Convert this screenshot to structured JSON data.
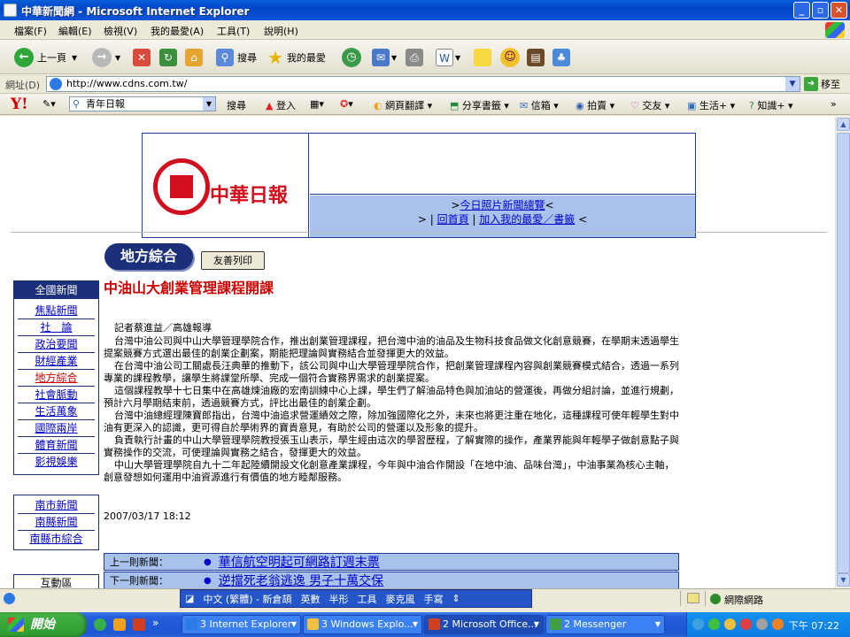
{
  "window": {
    "title": "中華新聞網 - Microsoft Internet Explorer"
  },
  "menu": [
    "檔案(F)",
    "編輯(E)",
    "檢視(V)",
    "我的最愛(A)",
    "工具(T)",
    "說明(H)"
  ],
  "toolbar": {
    "back": "上一頁",
    "search": "搜尋",
    "favorites": "我的最愛"
  },
  "address": {
    "label": "網址(D)",
    "url": "http://www.cdns.com.tw/",
    "go": "移至"
  },
  "yahoo": {
    "search_value": "青年日報",
    "items": [
      "搜尋",
      "登入",
      "網頁翻譯",
      "分享書籤",
      "信箱",
      "拍賣",
      "交友",
      "生活+",
      "知識+"
    ]
  },
  "banner": {
    "logo_text": "中華日報",
    "link_photos": "今日照片新聞總覽",
    "link_home": "回首頁",
    "link_fav": "加入我的最愛／書籤"
  },
  "section": {
    "title": "地方綜合",
    "print_button": "友善列印"
  },
  "nav": {
    "national_head": "全國新聞",
    "national_items": [
      "焦點新聞",
      "社　論",
      "政治要聞",
      "財經產業",
      "地方綜合",
      "社會脈動",
      "生活萬象",
      "國際兩岸",
      "體育新聞",
      "影視娛樂"
    ],
    "active_index": 4,
    "local_items": [
      "南市新聞",
      "南縣新聞",
      "南縣市綜合"
    ],
    "interactive_head": "互動區"
  },
  "article": {
    "title": "中油山大創業管理課程開課",
    "byline": "記者蔡進益／高雄報導",
    "paragraphs": [
      "台灣中油公司與中山大學管理學院合作，推出創業管理課程，把台灣中油的油品及生物科技食品做文化創意競賽，在學期末透過學生提案競賽方式選出最佳的創業企劃案，期能把理論與實務結合並發揮更大的效益。",
      "在台灣中油公司工關處長汪典華的推動下，該公司與中山大學管理學院合作，把創業管理課程內容與創業競賽模式結合，透過一系列專業的課程教學，讓學生將課堂所學、完成一個符合實務界需求的創業提案。",
      "這個課程教學十七日集中在高雄煉油廠的宏南訓練中心上課，學生們了解油品特色與加油站的營運後，再做分組討論，並進行規劃，預計六月學期結束前，透過競賽方式，評比出最佳的創業企劃。",
      "台灣中油總經理陳寶郎指出，台灣中油追求營運績效之際，除加強國際化之外，未來也將更注重在地化，這種課程可使年輕學生對中油有更深入的認識，更可得自於學術界的寶貴意見，有助於公司的營運以及形象的提升。",
      "負責執行計畫的中山大學管理學院教授張玉山表示，學生經由這次的學習歷程，了解實際的操作，產業界能與年輕學子做創意點子與實務操作的交流，可使理論與實務之結合，發揮更大的效益。",
      "中山大學管理學院自九十二年起陸續開設文化創意產業課程，今年與中油合作開設「在地中油、品味台灣」，中油事業為核心主軸，創意發想如何運用中油資源進行有價值的地方睦鄰服務。"
    ],
    "date": "2007/03/17 18:12"
  },
  "prevnext": {
    "prev_label": "上一則新聞：",
    "prev_title": "華信航空明起可網路訂週末票",
    "next_label": "下一則新聞：",
    "next_title": "逆擋死老翁逃逸 男子十萬交保"
  },
  "status": {
    "zone": "網際網路"
  },
  "langbar": [
    "中文 (繁體) - 新倉頡",
    "英數",
    "半形",
    "工具",
    "麥克風",
    "手寫"
  ],
  "taskbar": {
    "start": "開始",
    "tasks": [
      "3 Internet Explorer",
      "3 Windows Explo...",
      "2 Microsoft Office...",
      "2 Messenger"
    ],
    "clock": "下午 07:22"
  }
}
